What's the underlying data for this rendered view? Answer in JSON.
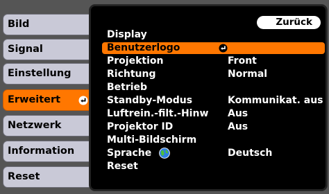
{
  "tabs": [
    {
      "label": "Bild"
    },
    {
      "label": "Signal"
    },
    {
      "label": "Einstellung"
    },
    {
      "label": "Erweitert"
    },
    {
      "label": "Netzwerk"
    },
    {
      "label": "Information"
    },
    {
      "label": "Reset"
    }
  ],
  "back_label": "Zurück",
  "rows": [
    {
      "label": "Display",
      "value": ""
    },
    {
      "label": "Benutzerlogo",
      "value": ""
    },
    {
      "label": "Projektion",
      "value": "Front"
    },
    {
      "label": "Richtung",
      "value": "Normal"
    },
    {
      "label": "Betrieb",
      "value": ""
    },
    {
      "label": "Standby-Modus",
      "value": "Kommunikat. aus"
    },
    {
      "label": "Luftrein.-filt.-Hinw",
      "value": "Aus"
    },
    {
      "label": "Projektor ID",
      "value": "Aus"
    },
    {
      "label": "Multi-Bildschirm",
      "value": ""
    },
    {
      "label": "Sprache",
      "value": "Deutsch"
    },
    {
      "label": "Reset",
      "value": ""
    }
  ],
  "icons": {
    "enter": "enter-icon",
    "globe": "globe-icon"
  },
  "colors": {
    "accent": "#ff7700",
    "tab": "#c9c9d7",
    "panel": "#000000"
  }
}
